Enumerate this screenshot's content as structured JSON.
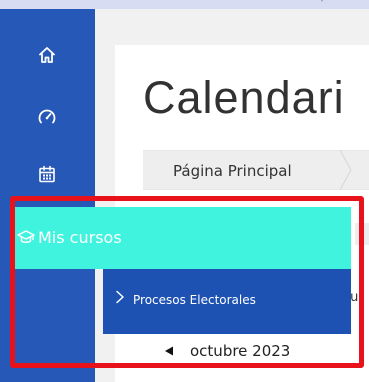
{
  "page": {
    "title": "Calendari"
  },
  "breadcrumb": {
    "home_label": "Página Principal"
  },
  "nav": {
    "items": [
      {
        "icon": "home-icon"
      },
      {
        "icon": "dashboard-icon"
      },
      {
        "icon": "calendar-icon"
      }
    ]
  },
  "menu": {
    "mis_cursos_label": "Mis cursos",
    "mis_cursos_icon": "graduation-cap-icon",
    "submenu_label": "Procesos Electorales",
    "submenu_icon": "chevron-right-icon"
  },
  "calendar": {
    "month_label": "octubre 2023",
    "prev_icon": "prev-month-icon"
  },
  "peek": {
    "text": "cu"
  },
  "colors": {
    "rail": "#2558b7",
    "menu_highlight": "#3ff3df",
    "submenu": "#1d52b3",
    "highlight_border": "#e8131a"
  }
}
